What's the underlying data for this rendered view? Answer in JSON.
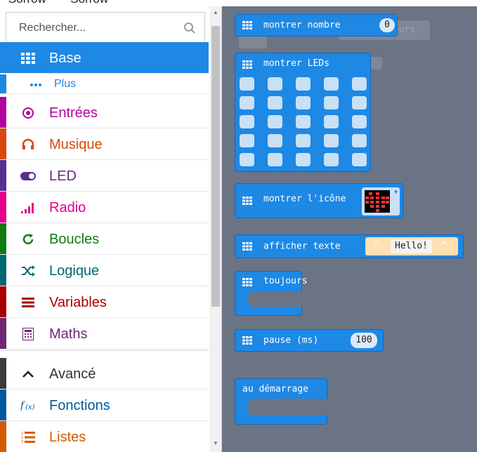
{
  "top_strip_text": "~Sorrow~ ~~Sorrow~~",
  "search": {
    "placeholder": "Rechercher...",
    "icon": "search-icon"
  },
  "categories": [
    {
      "label": "Base",
      "color": "#1e88e5",
      "icon": "grid-icon",
      "selected": true
    },
    {
      "label": "Plus",
      "color": "#1e88e5",
      "icon": "more-dots-icon",
      "sub": true
    },
    {
      "label": "Entrées",
      "color": "#b4009e",
      "icon": "radio-target-icon"
    },
    {
      "label": "Musique",
      "color": "#d9480f",
      "icon": "headphones-icon"
    },
    {
      "label": "LED",
      "color": "#5c2d91",
      "icon": "toggle-icon"
    },
    {
      "label": "Radio",
      "color": "#e3008c",
      "icon": "signal-bars-icon"
    },
    {
      "label": "Boucles",
      "color": "#107c10",
      "icon": "refresh-icon"
    },
    {
      "label": "Logique",
      "color": "#006970",
      "icon": "shuffle-icon"
    },
    {
      "label": "Variables",
      "color": "#a80000",
      "icon": "list-lines-icon"
    },
    {
      "label": "Maths",
      "color": "#712672",
      "icon": "calculator-icon"
    },
    {
      "label": "Avancé",
      "color": "#3c3c3c",
      "icon": "chevron-up-icon"
    },
    {
      "label": "Fonctions",
      "color": "#005a9e",
      "icon": "function-fx-icon"
    },
    {
      "label": "Listes",
      "color": "#d65b00",
      "icon": "numbered-list-icon"
    }
  ],
  "blocks": {
    "show_number": {
      "label": "montrer nombre",
      "value": "0"
    },
    "show_leds": {
      "label": "montrer LEDs"
    },
    "show_icon": {
      "label": "montrer l'icône"
    },
    "show_string": {
      "label": "afficher texte",
      "value": "Hello!",
      "open_quote": "“",
      "close_quote": "”"
    },
    "forever": {
      "label": "toujours"
    },
    "pause": {
      "label": "pause (ms)",
      "value": "100"
    },
    "on_start": {
      "label": "au démarrage"
    }
  },
  "ghost_text": "ours",
  "colors": {
    "base": "#1e88e5",
    "workspace": "#6b7485"
  }
}
